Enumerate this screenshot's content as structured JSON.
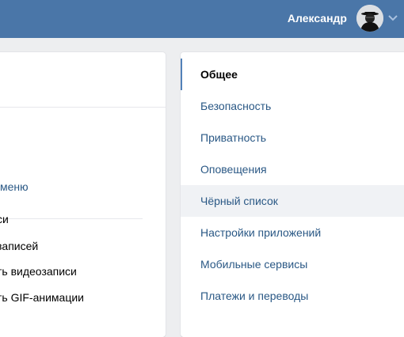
{
  "header": {
    "user_name": "Александр",
    "accent_color": "#4a76a8"
  },
  "left_panel": {
    "menu_link_partial": "меню",
    "items": [
      {
        "label": "си"
      },
      {
        "label": "записей"
      },
      {
        "label": "ть видеозаписи"
      },
      {
        "label": "ть GIF-анимации"
      }
    ]
  },
  "settings_nav": {
    "items": [
      {
        "label": "Общее",
        "state": "active"
      },
      {
        "label": "Безопасность"
      },
      {
        "label": "Приватность"
      },
      {
        "label": "Оповещения"
      },
      {
        "label": "Чёрный список",
        "state": "hover"
      },
      {
        "label": "Настройки приложений"
      },
      {
        "label": "Мобильные сервисы"
      },
      {
        "label": "Платежи и переводы"
      }
    ]
  },
  "icons": {
    "avatar": "avatar-icon",
    "dropdown": "chevron-down-icon"
  }
}
